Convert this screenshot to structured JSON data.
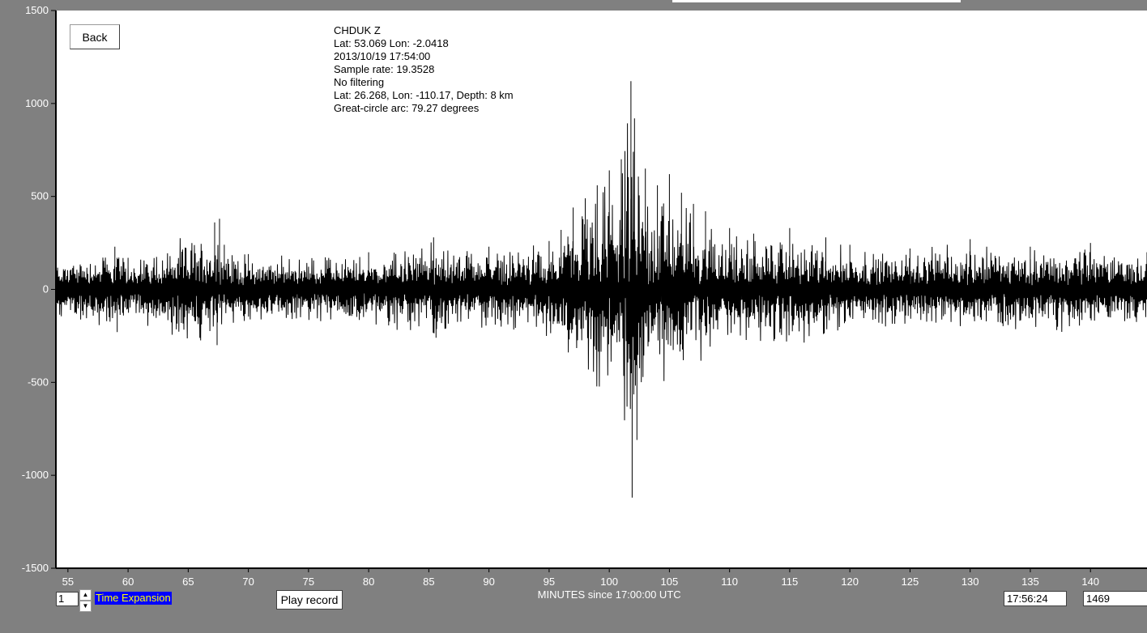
{
  "chart_data": {
    "type": "line",
    "xlabel": "MINUTES since 17:00:00 UTC",
    "xlim": [
      54,
      144.7
    ],
    "ylim": [
      -1500,
      1500
    ],
    "x_ticks": [
      55,
      60,
      65,
      70,
      75,
      80,
      85,
      90,
      95,
      100,
      105,
      110,
      115,
      120,
      125,
      130,
      135,
      140
    ],
    "y_ticks": [
      1500,
      1000,
      500,
      0,
      -500,
      -1000,
      -1500
    ],
    "grid": false,
    "series": [
      {
        "envelope": [
          {
            "x": 54.0,
            "y": 160
          },
          {
            "x": 58.9,
            "y": 230
          },
          {
            "x": 59.1,
            "y": -230
          },
          {
            "x": 60.0,
            "y": 170
          },
          {
            "x": 67.2,
            "y": 360
          },
          {
            "x": 67.4,
            "y": -300
          },
          {
            "x": 67.6,
            "y": 380
          },
          {
            "x": 68.0,
            "y": 240
          },
          {
            "x": 70.0,
            "y": 190
          },
          {
            "x": 80.0,
            "y": 200
          },
          {
            "x": 85.4,
            "y": 280
          },
          {
            "x": 85.6,
            "y": -260
          },
          {
            "x": 90.0,
            "y": 230
          },
          {
            "x": 95.0,
            "y": 260
          },
          {
            "x": 96.0,
            "y": 320
          },
          {
            "x": 97.0,
            "y": 440
          },
          {
            "x": 98.0,
            "y": 490
          },
          {
            "x": 99.0,
            "y": 560
          },
          {
            "x": 100.0,
            "y": 640
          },
          {
            "x": 101.0,
            "y": 700
          },
          {
            "x": 101.8,
            "y": 1120
          },
          {
            "x": 101.9,
            "y": -1120
          },
          {
            "x": 102.1,
            "y": 920
          },
          {
            "x": 102.3,
            "y": -810
          },
          {
            "x": 103.0,
            "y": 650
          },
          {
            "x": 104.0,
            "y": 560
          },
          {
            "x": 105.0,
            "y": 620
          },
          {
            "x": 106.0,
            "y": 520
          },
          {
            "x": 107.0,
            "y": 460
          },
          {
            "x": 108.0,
            "y": 420
          },
          {
            "x": 110.0,
            "y": 330
          },
          {
            "x": 112.0,
            "y": 300
          },
          {
            "x": 115.0,
            "y": 330
          },
          {
            "x": 118.0,
            "y": 280
          },
          {
            "x": 120.0,
            "y": 240
          },
          {
            "x": 125.0,
            "y": 220
          },
          {
            "x": 130.0,
            "y": 270
          },
          {
            "x": 135.0,
            "y": 230
          },
          {
            "x": 140.0,
            "y": 250
          },
          {
            "x": 144.7,
            "y": 200
          }
        ]
      }
    ]
  },
  "back_label": "Back",
  "info": {
    "station": "CHDUK  Z",
    "station_location": "Lat: 53.069 Lon: -2.0418",
    "datetime": "2013/10/19 17:54:00",
    "sample_rate": "Sample rate: 19.3528",
    "filter": "No filtering",
    "event_location": "Lat: 26.268, Lon: -110.17, Depth: 8 km",
    "great_circle": "Great-circle arc: 79.27 degrees"
  },
  "controls": {
    "time_expansion_value": "1",
    "time_expansion_label": "Time Expansion",
    "play_label": "Play record",
    "cursor_time": "17:56:24",
    "sample_count": "1469",
    "spin_up_icon": "chevron-up-icon",
    "spin_down_icon": "chevron-down-icon"
  },
  "colors": {
    "frame": "#808080",
    "plot_bg": "#ffffff",
    "trace": "#000000",
    "axis_text": "#ffffff",
    "label_fg": "#ffff00",
    "label_bg": "#0000ff"
  }
}
